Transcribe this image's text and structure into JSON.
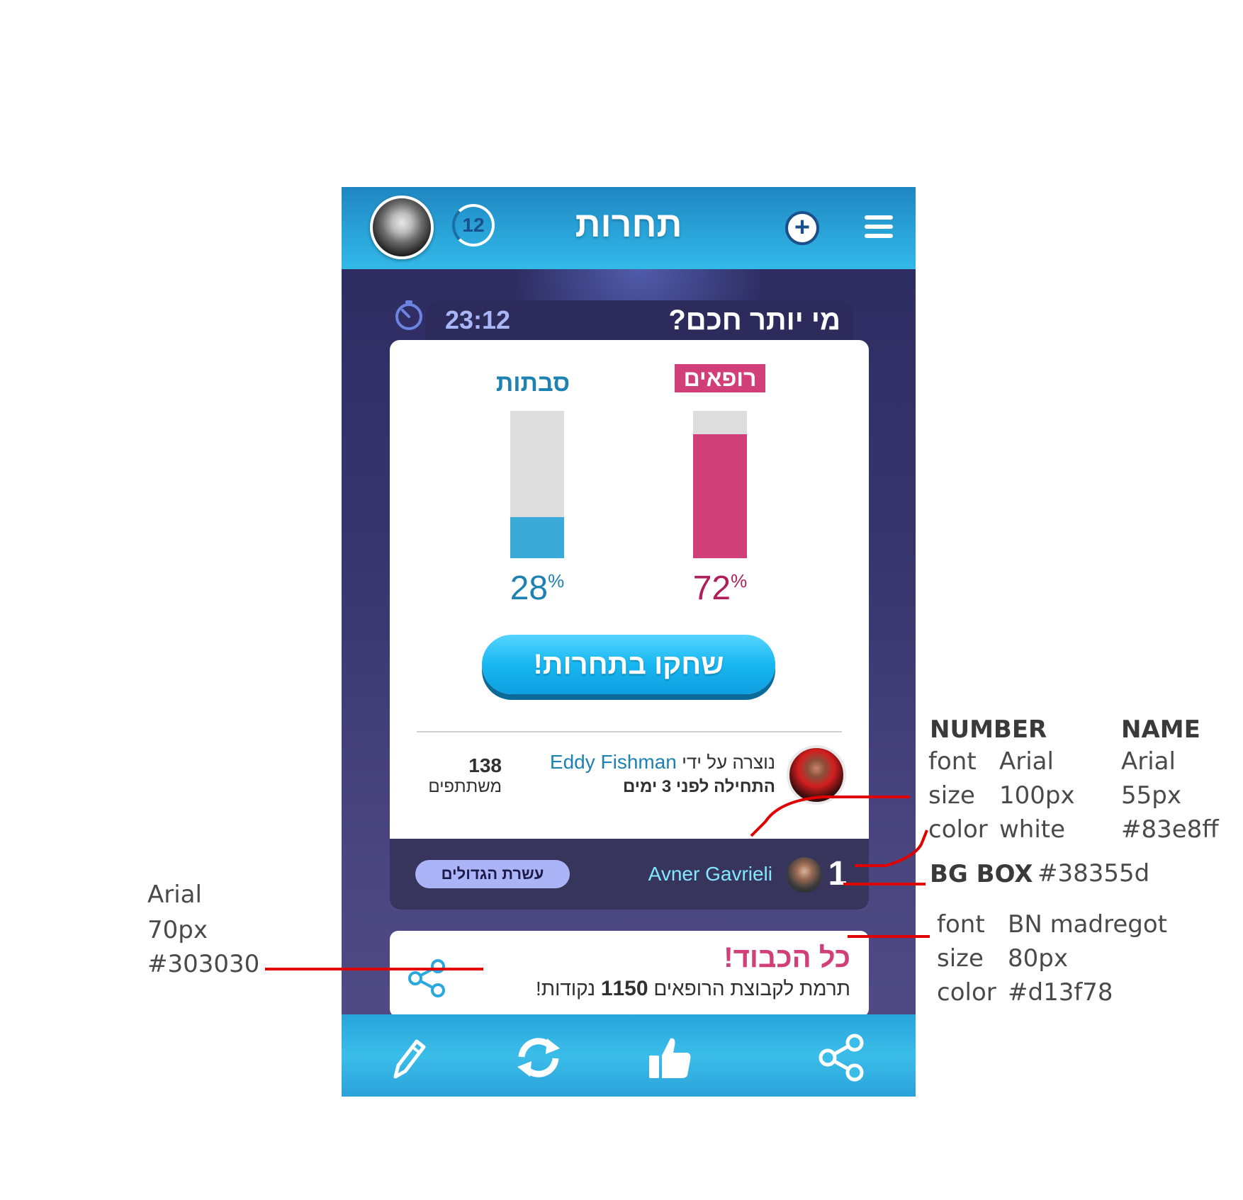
{
  "colors": {
    "header": "#29a3d8",
    "background": "#38356d",
    "accent_pink": "#d13f78",
    "accent_blue": "#1d81b2",
    "name_color": "#83e8ff",
    "leader_bg": "#38355d",
    "text_dark": "#303030"
  },
  "header": {
    "title": "תחרות",
    "notification_count": "12",
    "plus_icon": "plus-circle-icon",
    "menu_icon": "hamburger-menu-icon"
  },
  "quiz": {
    "title": "מי יותר חכם?",
    "timer": "23:12",
    "team_left": {
      "label": "סבתות",
      "percent": "28",
      "percent_sign": "%",
      "color": "#3aaad9"
    },
    "team_right": {
      "label": "רופאים",
      "percent": "72",
      "percent_sign": "%",
      "color": "#d13f78"
    },
    "play_button": "שחקו בתחרות!",
    "creator_prefix": "נוצרה על ידי",
    "creator_name": "Eddy Fishman",
    "started": "התחילה לפני 3 ימים",
    "participants_count": "138",
    "participants_label": "משתתפים"
  },
  "leaderboard": {
    "rank": "1",
    "name": "Avner Gavrieli",
    "top10_button": "עשרת הגדולים"
  },
  "bravo": {
    "title": "כל הכבוד!",
    "text_prefix": "תרמת לקבוצת הרופאים",
    "points": "1150",
    "text_suffix": "נקודות!"
  },
  "bottom_bar": {
    "icons": [
      "pencil-icon",
      "refresh-icon",
      "thumbs-up-icon",
      "share-icon"
    ]
  },
  "annotations": {
    "number_header": "NUMBER",
    "name_header": "NAME",
    "font_label": "font",
    "size_label": "size",
    "color_label": "color",
    "number_font": "Arial",
    "number_size": "100px",
    "number_color": "white",
    "name_font": "Arial",
    "name_size": "55px",
    "name_color": "#83e8ff",
    "bg_box_label": "BG BOX",
    "bg_box_color": "#38355d",
    "title_font": "BN madregot",
    "title_size": "80px",
    "title_color": "#d13f78",
    "sub_font": "Arial",
    "sub_size": "70px",
    "sub_color": "#303030"
  }
}
